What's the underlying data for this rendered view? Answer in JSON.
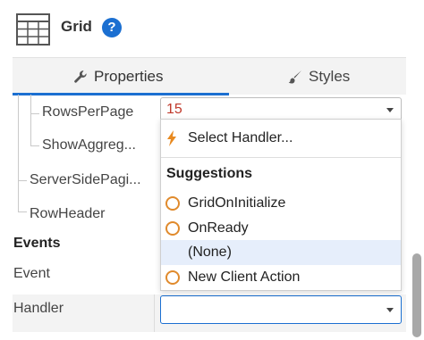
{
  "header": {
    "title": "Grid",
    "help_glyph": "?",
    "icon": "grid-table-icon"
  },
  "tabs": [
    {
      "label": "Properties",
      "icon": "wrench-icon",
      "active": true
    },
    {
      "label": "Styles",
      "icon": "brush-icon",
      "active": false
    }
  ],
  "properties": {
    "rows": [
      {
        "label": "RowsPerPage",
        "value": "15"
      },
      {
        "label": "ShowAggreg..."
      },
      {
        "label": "ServerSidePagi..."
      },
      {
        "label": "RowHeader"
      }
    ]
  },
  "events": {
    "section_title": "Events",
    "event_label": "Event",
    "handler_label": "Handler",
    "handler_value": ""
  },
  "dropdown": {
    "select_handler_label": "Select Handler...",
    "suggestions_title": "Suggestions",
    "items": [
      {
        "label": "GridOnInitialize",
        "selected": false
      },
      {
        "label": "OnReady",
        "selected": false
      },
      {
        "label": "(None)",
        "selected": true
      },
      {
        "label": "New Client Action",
        "selected": false
      }
    ]
  },
  "colors": {
    "accent": "#1b6fd1",
    "value_text": "#c0392b",
    "suggestion_circle": "#e08a2c",
    "bolt": "#e8891f",
    "selected_row": "#e6eefb"
  }
}
